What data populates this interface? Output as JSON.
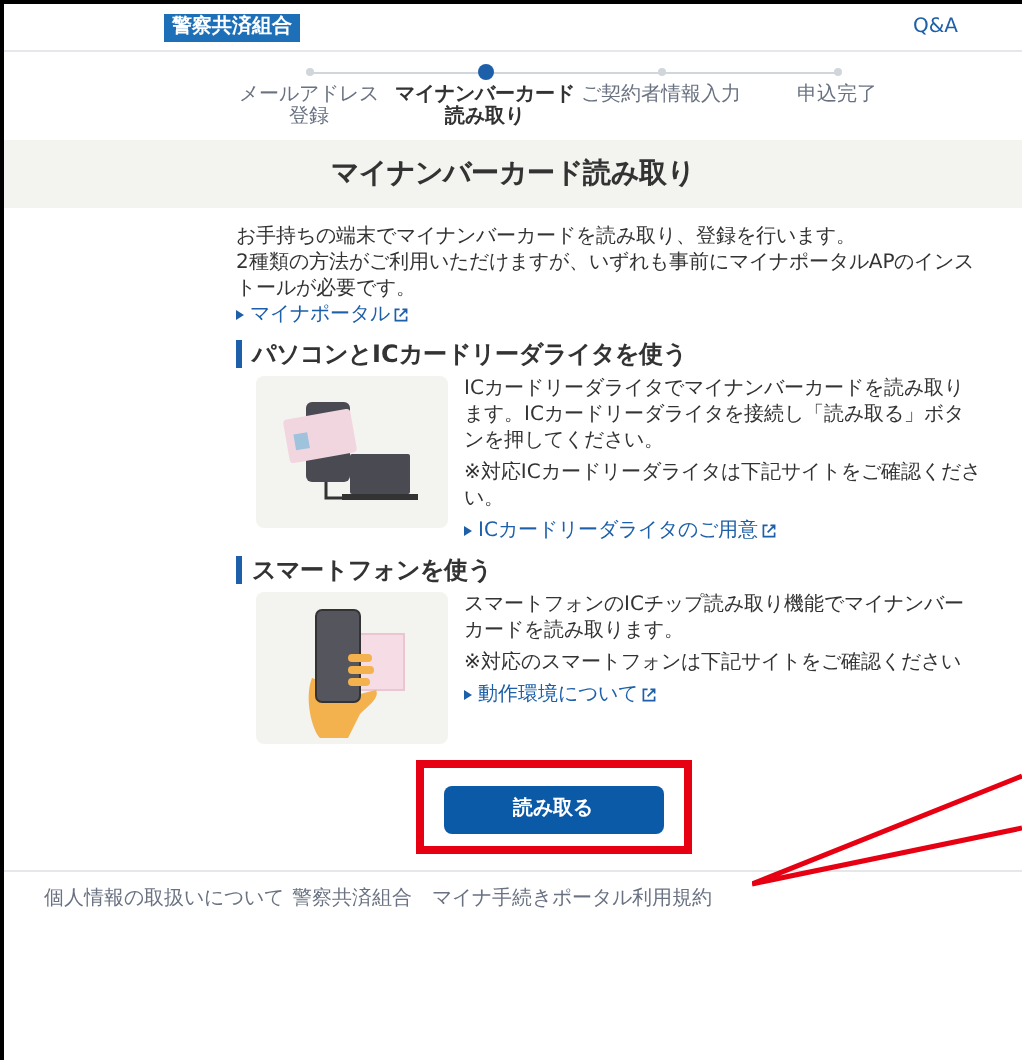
{
  "header": {
    "logo": "警察共済組合",
    "nav_link": "Q&A"
  },
  "steps": [
    {
      "label": [
        "メールアドレス",
        "登録"
      ],
      "selected": false
    },
    {
      "label": [
        "マイナンバーカード",
        "読み取り"
      ],
      "selected": true
    },
    {
      "label": [
        "ご契約者情報入力"
      ],
      "selected": false
    },
    {
      "label": [
        "申込完了"
      ],
      "selected": false
    }
  ],
  "page_title": "マイナンバーカード読み取り",
  "intro": [
    "お手持ちの端末でマイナンバーカードを読み取り、登録を行います。",
    "2種類の方法がご利用いただけますが、いずれも事前にマイナポータルAPのインストールが必要です。"
  ],
  "intro_link": "マイナポータル",
  "sections": [
    {
      "kind": "pc",
      "heading": "パソコンとICカードリーダライタを使う",
      "paragraphs": [
        "ICカードリーダライタでマイナンバーカードを読み取ります。ICカードリーダライタを接続し「読み取る」ボタンを押してください。",
        "※対応ICカードリーダライタは下記サイトをご確認ください。"
      ],
      "link": "ICカードリーダライタのご用意"
    },
    {
      "kind": "phone",
      "heading": "スマートフォンを使う",
      "paragraphs": [
        "スマートフォンのICチップ読み取り機能でマイナンバーカードを読み取ります。",
        "※対応のスマートフォンは下記サイトをご確認ください"
      ],
      "link": "動作環境について"
    }
  ],
  "read_button": "読み取る",
  "footer_links": [
    "個人情報の取扱いについて",
    "警察共済組合　マイナ手続きポータル利用規約"
  ]
}
